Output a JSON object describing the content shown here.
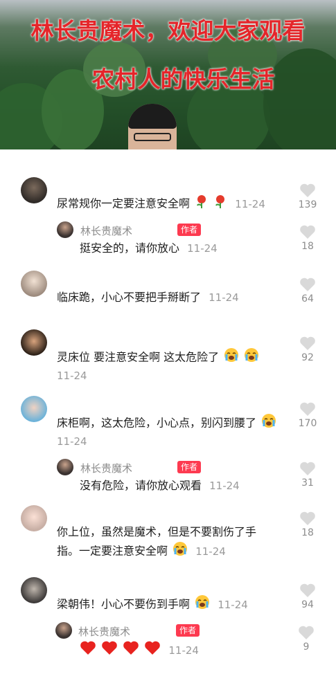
{
  "video": {
    "title_line1": "林长贵魔术，欢迎大家观看",
    "title_line2": "农村人的快乐生活"
  },
  "comments": [
    {
      "text": "尿常规你一定要注意安全啊",
      "emoji": "rose-emoji rose-emoji",
      "time": "11-24",
      "likes": "139"
    },
    {
      "author": "林长贵魔术",
      "badge": "作者",
      "text": "挺安全的，请你放心",
      "time": "11-24",
      "likes": "18"
    },
    {
      "text": "临床跪，小心不要把手掰断了",
      "time": "11-24",
      "likes": "64"
    },
    {
      "text": "灵床位 要注意安全啊 这太危险了",
      "emoji": "crying-emoji crying-emoji",
      "time": "11-24",
      "likes": "92"
    },
    {
      "text": "床柜啊，这太危险，小心点，别闪到腰了",
      "emoji": "crying-emoji",
      "time": "11-24",
      "likes": "170"
    },
    {
      "author": "林长贵魔术",
      "badge": "作者",
      "text": "没有危险，请你放心观看",
      "time": "11-24",
      "likes": "31"
    },
    {
      "text_line1": "你上位，虽然是魔术，但是不要割伤了手",
      "text_line2": "指。一定要注意安全啊",
      "emoji": "crying-emoji",
      "time": "11-24",
      "likes": "18"
    },
    {
      "text": "梁朝伟！小心不要伤到手啊",
      "emoji": "crying-emoji",
      "time": "11-24",
      "likes": "94"
    },
    {
      "author": "林长贵魔术",
      "badge": "作者",
      "emoji": "heart-emoji heart-emoji heart-emoji heart-emoji",
      "time": "11-24",
      "likes": "9"
    }
  ]
}
